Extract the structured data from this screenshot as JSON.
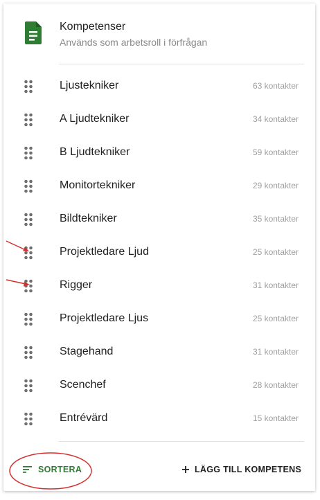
{
  "header": {
    "title": "Kompetenser",
    "subtitle": "Används som arbetsroll i förfrågan",
    "icon": "document-icon",
    "accent_color": "#2e7d32"
  },
  "items": [
    {
      "label": "Ljustekniker",
      "count": "63 kontakter"
    },
    {
      "label": "A Ljudtekniker",
      "count": "34 kontakter"
    },
    {
      "label": "B Ljudtekniker",
      "count": "59 kontakter"
    },
    {
      "label": "Monitortekniker",
      "count": "29 kontakter"
    },
    {
      "label": "Bildtekniker",
      "count": "35 kontakter"
    },
    {
      "label": "Projektledare Ljud",
      "count": "25 kontakter"
    },
    {
      "label": "Rigger",
      "count": "31 kontakter"
    },
    {
      "label": "Projektledare Ljus",
      "count": "25 kontakter"
    },
    {
      "label": "Stagehand",
      "count": "31 kontakter"
    },
    {
      "label": "Scenchef",
      "count": "28 kontakter"
    },
    {
      "label": "Entrévärd",
      "count": "15 kontakter"
    }
  ],
  "footer": {
    "sort_label": "SORTERA",
    "add_label": "LÄGG TILL KOMPETENS"
  },
  "annotation_color": "#d32f2f"
}
